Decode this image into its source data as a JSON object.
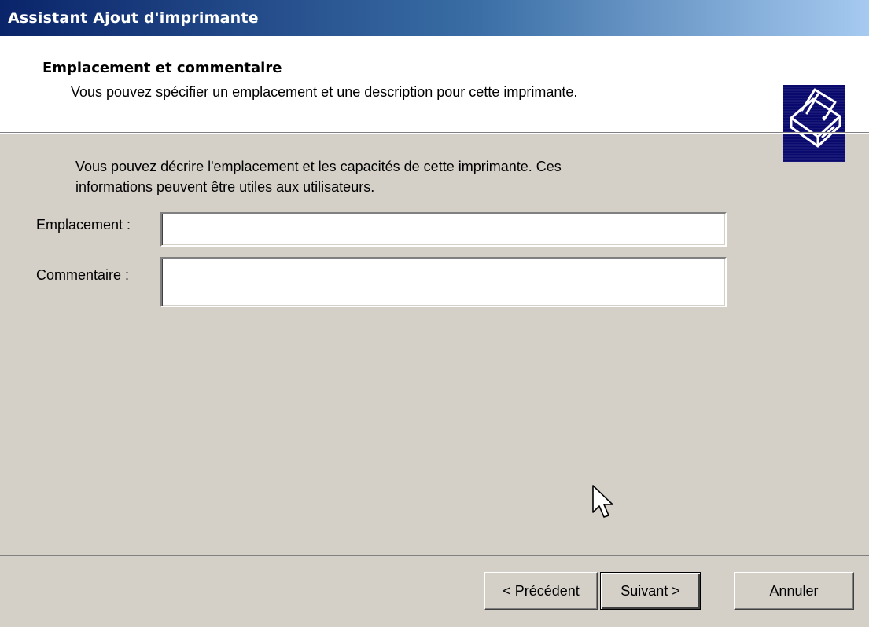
{
  "window": {
    "title": "Assistant Ajout d'imprimante"
  },
  "header": {
    "title": "Emplacement et commentaire",
    "subtitle": "Vous pouvez spécifier un emplacement et une description pour cette imprimante.",
    "icon": "printer-icon"
  },
  "body": {
    "intro_line1": "Vous pouvez décrire l'emplacement et les capacités de cette imprimante. Ces",
    "intro_line2": "informations peuvent être utiles aux utilisateurs.",
    "location_label": "Emplacement :",
    "location_value": "",
    "comment_label": "Commentaire :",
    "comment_value": ""
  },
  "buttons": {
    "back": "< Précédent",
    "next": "Suivant >",
    "cancel": "Annuler"
  },
  "colors": {
    "titlebar_start": "#0a246a",
    "titlebar_end": "#a6caf0",
    "dialog_bg": "#d4d0c8",
    "icon_bg": "#0a0a6e"
  },
  "cursor": "arrow-cursor-icon"
}
